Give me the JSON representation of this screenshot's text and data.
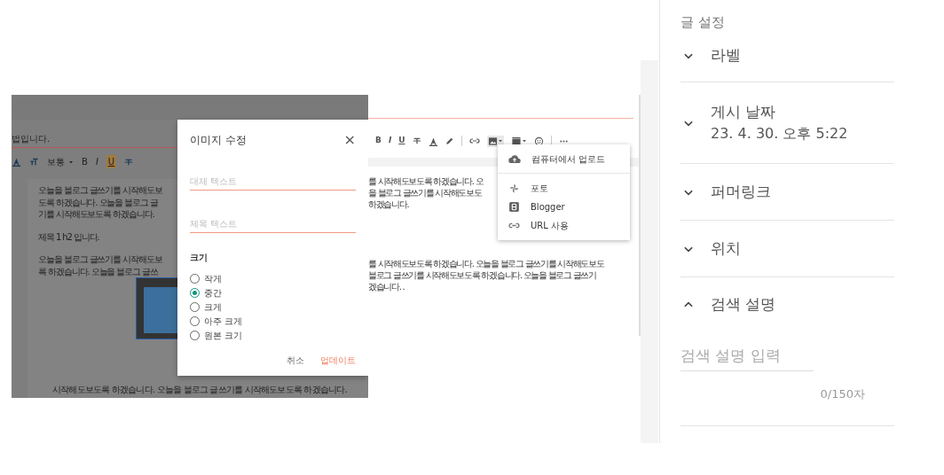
{
  "editor_screenshot": {
    "post_title": "법입니다.",
    "toolbar": [
      {
        "kind": "text-color",
        "active": false
      },
      {
        "kind": "font-size",
        "active": false
      },
      {
        "kind": "dropdown",
        "label": "보통",
        "active": false
      },
      {
        "kind": "bold",
        "label": "B",
        "active": false
      },
      {
        "kind": "italic",
        "label": "I",
        "active": false
      },
      {
        "kind": "underline",
        "label": "U",
        "active": true
      },
      {
        "kind": "strike",
        "active": false
      }
    ],
    "paragraphs": [
      [
        "오늘을  블로그 글쓰기를 시작해도보",
        "도록 하겠습니다. 오늘을  블로그 글",
        "기를 시작해도보도록 하겠습니다."
      ],
      [
        "제목 1 h2 입니다."
      ],
      [
        "오늘을  블로그 글쓰기를 시작해도보",
        "록 하겠습니다. 오늘을  블로그 글쓰"
      ]
    ],
    "bottom_line": "시작해도보도록 하겠습니다. 오늘을  블로그 글쓰기를 시작해도보도록 하겠습니다.",
    "dialog": {
      "title": "이미지 수정",
      "close": "×",
      "fields": [
        {
          "placeholder": "대체 텍스트"
        },
        {
          "placeholder": "제목 텍스트"
        }
      ],
      "size_label": "크기",
      "sizes": [
        {
          "label": "작게",
          "selected": false
        },
        {
          "label": "중간",
          "selected": true
        },
        {
          "label": "크게",
          "selected": false
        },
        {
          "label": "아주 크게",
          "selected": false
        },
        {
          "label": "원본 크기",
          "selected": false
        }
      ],
      "buttons": [
        {
          "kind": "cancel",
          "label": "취소"
        },
        {
          "kind": "primary",
          "label": "업데이트"
        }
      ]
    }
  },
  "editor_screenshot_2": {
    "toolbar": [
      {
        "kind": "bold",
        "label": "B"
      },
      {
        "kind": "italic",
        "label": "I"
      },
      {
        "kind": "underline",
        "label": "U"
      },
      {
        "kind": "strike"
      },
      {
        "kind": "text-color"
      },
      {
        "kind": "highlight"
      },
      {
        "kind": "divider"
      },
      {
        "kind": "link"
      },
      {
        "kind": "image",
        "open": true
      },
      {
        "kind": "video",
        "open": false
      },
      {
        "kind": "emoji"
      },
      {
        "kind": "divider"
      },
      {
        "kind": "more"
      }
    ],
    "paragraphs": [
      [
        "를 시작해도보도록 하겠습니다. 오",
        "을  블로그 글쓰기를 시작해도보도",
        "하겠습니다."
      ],
      [
        "를 시작해도보도록 하겠습니다. 오늘을  블로그 글쓰기를 시작해도보도",
        " 블로그 글쓰기를 시작해도보도록 하겠습니다. 오늘을  블로그 글쓰기",
        "겠습니다. ."
      ]
    ],
    "image_menu": [
      {
        "kind": "upload",
        "label": "컴퓨터에서 업로드"
      },
      {
        "kind": "photos",
        "label": "포토"
      },
      {
        "kind": "blogger",
        "label": "Blogger"
      },
      {
        "kind": "url",
        "label": "URL 사용"
      }
    ]
  },
  "post_settings": {
    "title": "글 설정",
    "sections": [
      {
        "label": "라벨",
        "expanded": false
      },
      {
        "label": "게시 날짜",
        "value": "23. 4. 30. 오후 5:22",
        "expanded": false
      },
      {
        "label": "퍼머링크",
        "expanded": false
      },
      {
        "label": "위치",
        "expanded": false
      },
      {
        "label": "검색 설명",
        "expanded": true
      }
    ],
    "search_description": {
      "placeholder": "검색 설명 입력",
      "counter": "0/150자"
    }
  }
}
